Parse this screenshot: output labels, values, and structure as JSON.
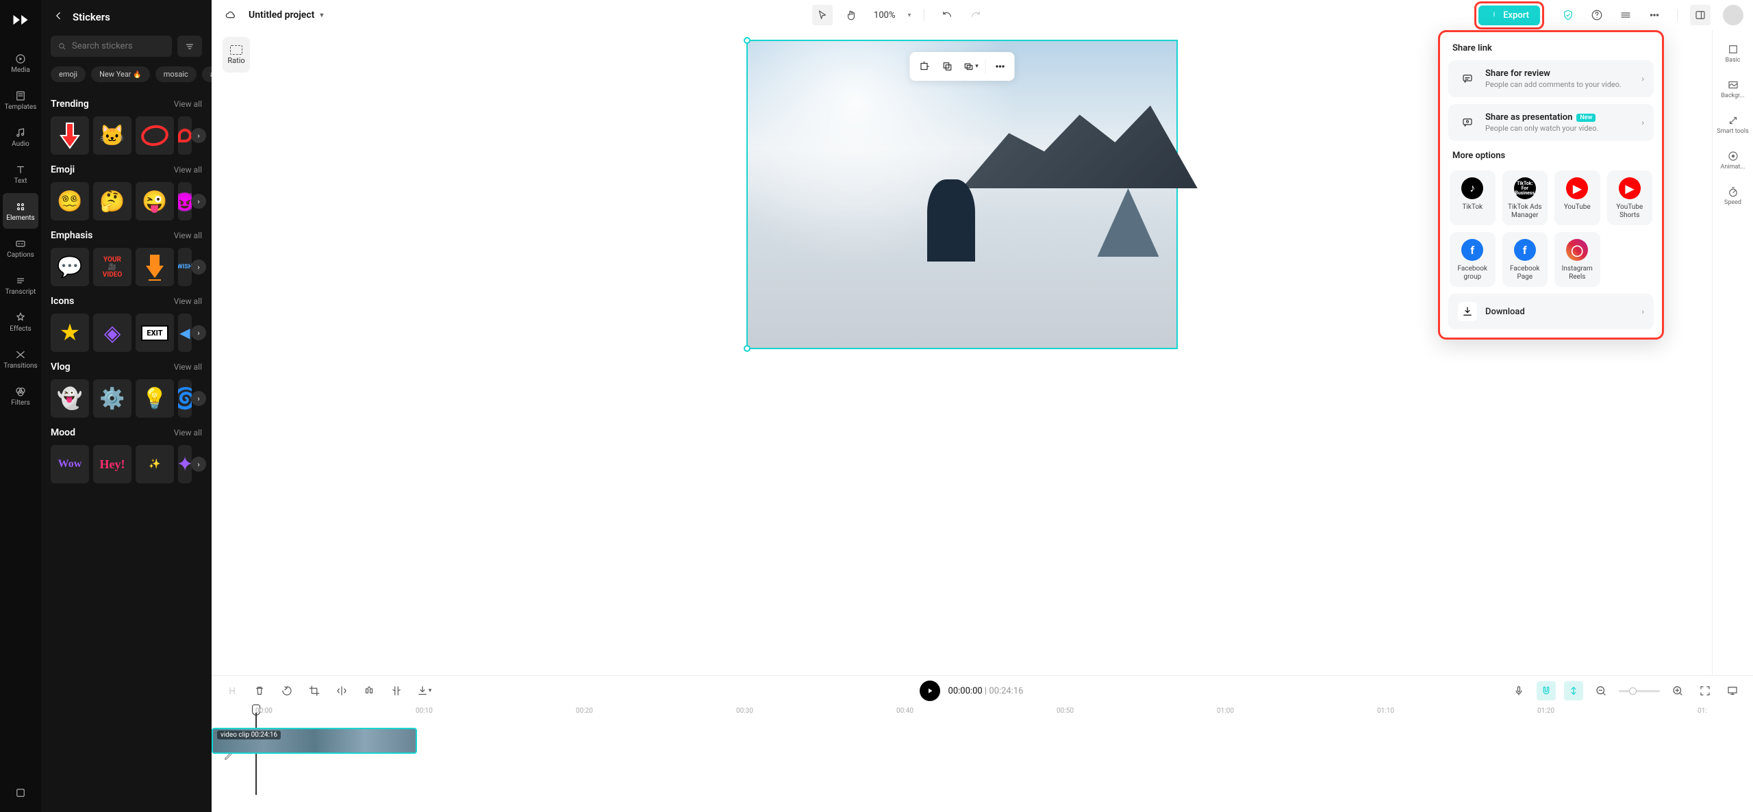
{
  "nav": {
    "items": [
      {
        "label": "Media"
      },
      {
        "label": "Templates"
      },
      {
        "label": "Audio"
      },
      {
        "label": "Text"
      },
      {
        "label": "Elements"
      },
      {
        "label": "Captions"
      },
      {
        "label": "Transcript"
      },
      {
        "label": "Effects"
      },
      {
        "label": "Transitions"
      },
      {
        "label": "Filters"
      }
    ]
  },
  "stickers": {
    "title": "Stickers",
    "search_placeholder": "Search stickers",
    "chips": [
      "emoji",
      "New Year",
      "mosaic",
      "arro"
    ],
    "view_all": "View all",
    "categories": [
      {
        "title": "Trending"
      },
      {
        "title": "Emoji"
      },
      {
        "title": "Emphasis"
      },
      {
        "title": "Icons"
      },
      {
        "title": "Vlog"
      },
      {
        "title": "Mood"
      }
    ]
  },
  "topbar": {
    "project_title": "Untitled project",
    "zoom": "100%",
    "export": "Export",
    "ratio": "Ratio"
  },
  "share": {
    "title": "Share link",
    "review": {
      "title": "Share for review",
      "desc": "People can add comments to your video."
    },
    "presentation": {
      "title": "Share as presentation",
      "badge": "New",
      "desc": "People can only watch your video."
    },
    "more": "More options",
    "socials": [
      {
        "label": "TikTok"
      },
      {
        "label": "TikTok Ads Manager"
      },
      {
        "label": "YouTube"
      },
      {
        "label": "YouTube Shorts"
      },
      {
        "label": "Facebook group"
      },
      {
        "label": "Facebook Page"
      },
      {
        "label": "Instagram Reels"
      }
    ],
    "download": "Download"
  },
  "right_rail": {
    "items": [
      "Basic",
      "Backgr...",
      "Smart tools",
      "Animat...",
      "Speed"
    ]
  },
  "timeline": {
    "current": "00:00:00",
    "duration": "00:24:16",
    "marks": [
      "00:00",
      "00:10",
      "00:20",
      "00:30",
      "00:40",
      "00:50",
      "01:00",
      "01:10",
      "01:20",
      "01:"
    ],
    "clip": {
      "name": "video clip",
      "dur": "00:24:16"
    }
  }
}
